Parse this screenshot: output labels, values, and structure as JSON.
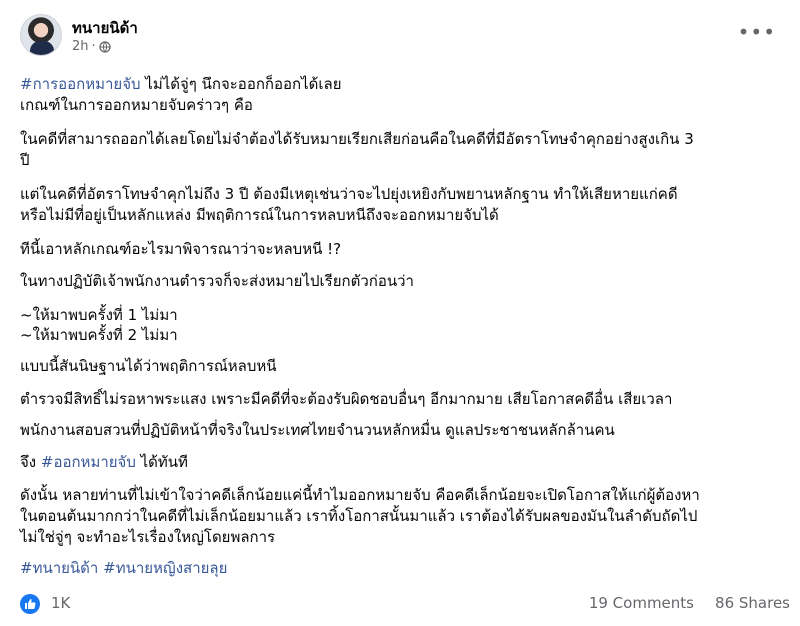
{
  "post": {
    "author": "ทนายนิด้า",
    "time": "2h",
    "privacy_icon": "globe-icon",
    "menu_icon": "more-icon",
    "paragraphs": [
      {
        "tag": "#การออกหมายจับ",
        "text": " ไม่ได้จู่ๆ นึกจะออกก็ออกได้เลย"
      },
      {
        "text": "เกณฑ์ในการออกหมายจับคร่าวๆ คือ"
      },
      {
        "text": "ในคดีที่สามารถออกได้เลยโดยไม่จำต้องได้รับหมายเรียกเสียก่อนคือในคดีที่มีอัตราโทษจำคุกอย่างสูงเกิน 3"
      },
      {
        "text": "ปี"
      },
      {
        "text": "แต่ในคดีที่อัตราโทษจำคุกไม่ถึง 3 ปี ต้องมีเหตุเช่นว่าจะไปยุ่งเหยิงกับพยานหลักฐาน ทำให้เสียหายแก่คดี"
      },
      {
        "text": "หรือไม่มีที่อยู่เป็นหลักแหล่ง มีพฤติการณ์ในการหลบหนีถึงจะออกหมายจับได้"
      },
      {
        "text": "ทีนี้เอาหลักเกณฑ์อะไรมาพิจารณาว่าจะหลบหนี !?"
      },
      {
        "text": "ในทางปฏิบัติเจ้าพนักงานตำรวจก็จะส่งหมายไปเรียกตัวก่อนว่า"
      },
      {
        "text": " ~ให้มาพบครั้งที่ 1 ไม่มา"
      },
      {
        "text": " ~ให้มาพบครั้งที่ 2 ไม่มา"
      },
      {
        "text": "แบบนี้สันนิษฐานได้ว่าพฤติการณ์หลบหนี"
      },
      {
        "text": "ตำรวจมีสิทธิ์ไม่รอหาพระแสง เพราะมีคดีที่จะต้องรับผิดชอบอื่นๆ อีกมากมาย เสียโอกาสคดีอื่น เสียเวลา"
      },
      {
        "text": "พนักงานสอบสวนที่ปฏิบัติหน้าที่จริงในประเทศไทยจำนวนหลักหมื่น ดูแลประชาชนหลักล้านคน"
      },
      {
        "prefix": "จึง ",
        "tag": "#ออกหมายจับ",
        "text": " ได้ทันที"
      },
      {
        "text": "ดังนั้น หลายท่านที่ไม่เข้าใจว่าคดีเล็กน้อยแค่นี้ทำไมออกหมายจับ คือคดีเล็กน้อยจะเปิดโอกาสให้แก่ผู้ต้องหา"
      },
      {
        "text": "ในตอนต้นมากกว่าในคดีที่ไม่เล็กน้อยมาแล้ว เราทิ้งโอกาสนั้นมาแล้ว เราต้องได้รับผลของมันในลำดับถัดไป"
      },
      {
        "text": "ไม่ใช่จู่ๆ จะทำอะไรเรื่องใหญ่โดยพลการ"
      },
      {
        "tags": [
          "#ทนายนิด้า",
          "#ทนายหญิงสายลุย"
        ]
      }
    ],
    "reactions": {
      "icon": "like-icon",
      "count": "1K"
    },
    "comments": "19 Comments",
    "shares": "86 Shares",
    "colors": {
      "link": "#385898",
      "like": "#1877f2",
      "meta": "#65676b"
    }
  }
}
